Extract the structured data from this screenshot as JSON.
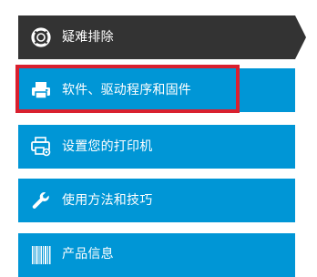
{
  "menu": {
    "items": [
      {
        "label": "疑难排除",
        "icon": "lifebuoy-icon",
        "active": true
      },
      {
        "label": "软件、驱动程序和固件",
        "icon": "printer-icon",
        "active": false,
        "highlighted": true
      },
      {
        "label": "设置您的打印机",
        "icon": "printer-setup-icon",
        "active": false
      },
      {
        "label": "使用方法和技巧",
        "icon": "wrench-icon",
        "active": false
      },
      {
        "label": "产品信息",
        "icon": "barcode-icon",
        "active": false
      }
    ]
  },
  "colors": {
    "item_background": "#0096d6",
    "active_background": "#333333",
    "highlight_border": "#d9202f",
    "text": "#ffffff"
  }
}
